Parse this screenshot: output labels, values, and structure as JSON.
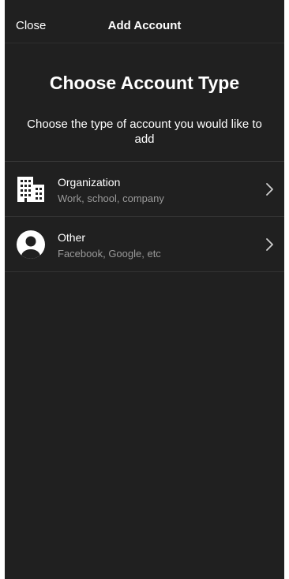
{
  "navbar": {
    "close_label": "Close",
    "title": "Add Account"
  },
  "header": {
    "heading": "Choose Account Type",
    "subheading": "Choose the type of account you would like to add"
  },
  "account_types": [
    {
      "title": "Organization",
      "subtitle": "Work, school, company",
      "icon": "building-icon"
    },
    {
      "title": "Other",
      "subtitle": "Facebook, Google, etc",
      "icon": "person-circle-icon"
    }
  ],
  "colors": {
    "background": "#202020",
    "text": "#ffffff",
    "secondary_text": "#9a9a9a",
    "separator": "#333333"
  }
}
